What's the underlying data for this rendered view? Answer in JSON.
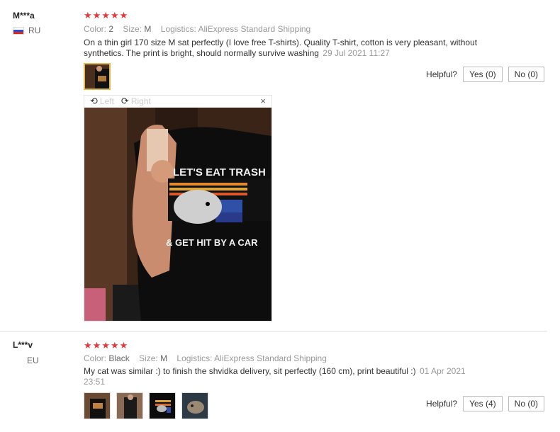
{
  "reviews": [
    {
      "user": "M***a",
      "country": "RU",
      "stars": 5,
      "attrs": {
        "color_label": "Color:",
        "color": "2",
        "size_label": "Size:",
        "size": "M",
        "logistics_label": "Logistics:",
        "logistics": "AliExpress Standard Shipping"
      },
      "text": "On a thin girl 170 size M sat perfectly (I love free T-shirts). Quality T-shirt, cotton is very pleasant, without synthetics. The print is bright, should normally survive washing",
      "date": "29 Jul 2021 11:27",
      "helpful_label": "Helpful?",
      "yes": "Yes (0)",
      "no": "No (0)",
      "viewer": {
        "left_label": "Left",
        "right_label": "Right",
        "close": "×",
        "shirt_line1": "LET'S EAT TRASH",
        "shirt_line2": "& GET HIT BY A CAR"
      }
    },
    {
      "user": "L***v",
      "country": "EU",
      "stars": 5,
      "attrs": {
        "color_label": "Color:",
        "color": "Black",
        "size_label": "Size:",
        "size": "M",
        "logistics_label": "Logistics:",
        "logistics": "AliExpress Standard Shipping"
      },
      "text": "My cat was similar :) to finish the shvidka delivery, sit perfectly (160 cm), print beautiful :)",
      "date": "01 Apr 2021 23:51",
      "helpful_label": "Helpful?",
      "yes": "Yes (4)",
      "no": "No (0)"
    }
  ],
  "star_glyph": "★",
  "colors": {
    "star": "#e4393c",
    "active_thumb_border": "#e4bb50"
  }
}
